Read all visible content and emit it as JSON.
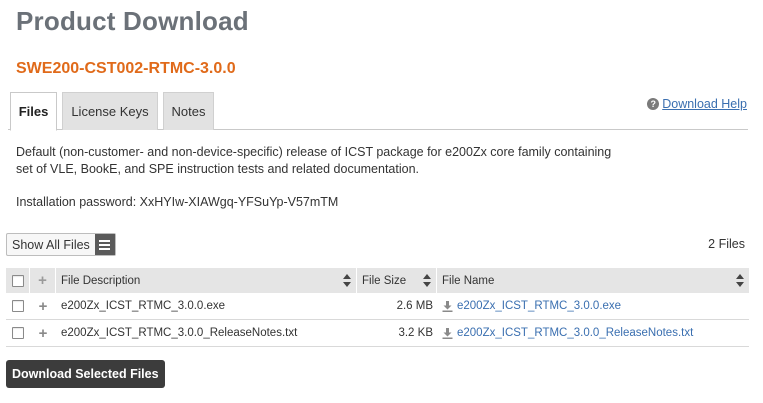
{
  "page": {
    "title": "Product Download",
    "product_id": "SWE200-CST002-RTMC-3.0.0"
  },
  "tabs": [
    {
      "label": "Files",
      "active": true
    },
    {
      "label": "License Keys",
      "active": false
    },
    {
      "label": "Notes",
      "active": false
    }
  ],
  "help": {
    "icon": "help-icon",
    "label": "Download Help"
  },
  "description": {
    "line1": "Default (non-customer- and non-device-specific) release of ICST package for e200Zx core family containing",
    "line2": "set of VLE, BookE, and SPE instruction tests and related documentation."
  },
  "password": {
    "text": "Installation password: XxHYIw-XIAWgq-YFSuYp-V57mTM"
  },
  "filter": {
    "label": "Show All Files",
    "icon": "menu-icon"
  },
  "file_count": "2 Files",
  "table": {
    "headers": {
      "plus": "+",
      "description": "File Description",
      "size": "File Size",
      "name": "File Name"
    },
    "rows": [
      {
        "description": "e200Zx_ICST_RTMC_3.0.0.exe",
        "size": "2.6 MB",
        "name": "e200Zx_ICST_RTMC_3.0.0.exe"
      },
      {
        "description": "e200Zx_ICST_RTMC_3.0.0_ReleaseNotes.txt",
        "size": "3.2 KB",
        "name": "e200Zx_ICST_RTMC_3.0.0_ReleaseNotes.txt"
      }
    ]
  },
  "download_button": "Download Selected Files",
  "colors": {
    "title": "#6b7178",
    "accent": "#e06a1a",
    "link": "#3a6fb0",
    "button": "#3c3c3c"
  }
}
